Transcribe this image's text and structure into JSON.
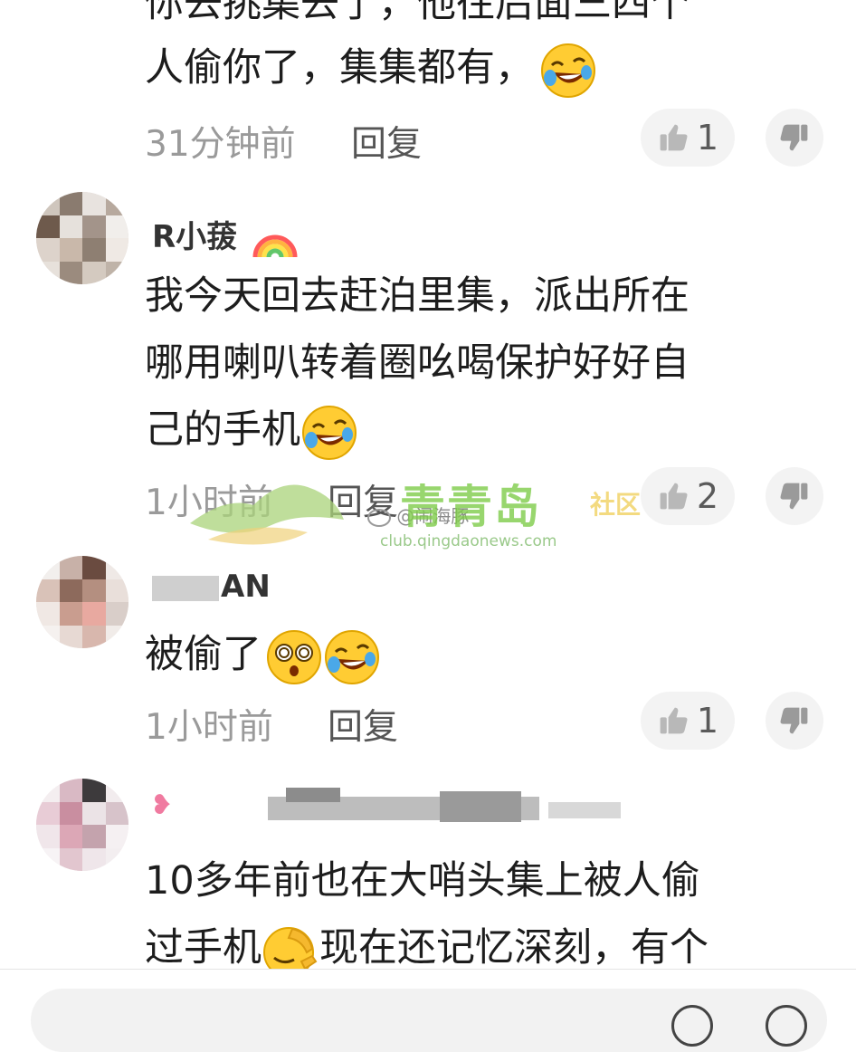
{
  "comments": [
    {
      "lines": [
        "你去挑集去了，他往后面三四个",
        "人偷你了，集集都有，"
      ],
      "time": "31分钟前",
      "reply": "回复",
      "likes": "1"
    },
    {
      "username": "R小菝",
      "lines": [
        "我今天回去赶泊里集，派出所在",
        "哪用喇叭转着圈吆喝保护好好自",
        "己的手机"
      ],
      "time": "1小时前",
      "reply": "回复",
      "likes": "2"
    },
    {
      "username": "AN",
      "lines": [
        "被偷了"
      ],
      "time": "1小时前",
      "reply": "回复",
      "likes": "1"
    },
    {
      "lines": [
        "10多年前也在大哨头集上被人偷",
        "过手机",
        "现在还记忆深刻，有个"
      ]
    }
  ],
  "watermark": {
    "name": "青青岛",
    "suffix": "社区",
    "url": "club.qingdaonews.com",
    "weibo": "@闹海豚"
  },
  "icons": {
    "like": "thumbs-up-icon",
    "dislike": "thumbs-down-icon",
    "laugh": "rolling-laughing-emoji",
    "dizzy": "dizzy-face-emoji",
    "facepalm": "facepalm-emoji",
    "rainbow": "rainbow-emoji"
  }
}
